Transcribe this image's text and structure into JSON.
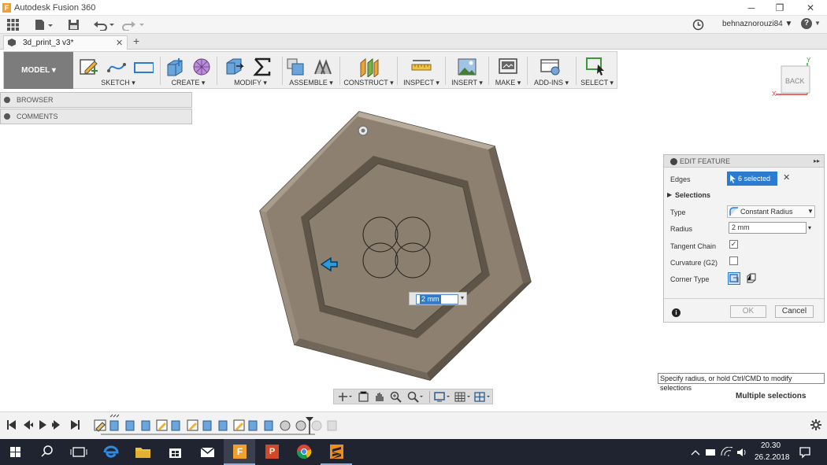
{
  "app": {
    "title": "Autodesk Fusion 360"
  },
  "window_controls": {
    "minimize": "─",
    "restore": "❐",
    "close": "✕"
  },
  "qat": {
    "user": "behnaznorouzi84 ▼",
    "help": "?"
  },
  "tab": {
    "name": "3d_print_3 v3*",
    "close": "✕",
    "add": "+"
  },
  "toolbar": {
    "workspace": "MODEL ▾",
    "groups": [
      {
        "label": "SKETCH ▾"
      },
      {
        "label": "CREATE ▾"
      },
      {
        "label": "MODIFY ▾"
      },
      {
        "label": "ASSEMBLE ▾"
      },
      {
        "label": "CONSTRUCT ▾"
      },
      {
        "label": "INSPECT ▾"
      },
      {
        "label": "INSERT ▾"
      },
      {
        "label": "MAKE ▾"
      },
      {
        "label": "ADD-INS ▾"
      },
      {
        "label": "SELECT ▾"
      }
    ]
  },
  "panels": {
    "browser": "BROWSER",
    "comments": "COMMENTS"
  },
  "viewcube": {
    "face": "BACK",
    "x": "X",
    "y": "Y"
  },
  "viewport": {
    "radius_input": "2 mm"
  },
  "edit_feature": {
    "title": "EDIT FEATURE",
    "edges_label": "Edges",
    "edges_value": "6 selected",
    "selections_label": "Selections",
    "type_label": "Type",
    "type_value": "Constant Radius",
    "radius_label": "Radius",
    "radius_value": "2 mm",
    "tangent_label": "Tangent Chain",
    "tangent_checked": true,
    "curvature_label": "Curvature (G2)",
    "curvature_checked": false,
    "corner_label": "Corner Type",
    "ok": "OK",
    "cancel": "Cancel"
  },
  "tooltip": "Specify radius, or hold Ctrl/CMD to modify selections",
  "status": "Multiple selections",
  "taskbar": {
    "time": "20.30",
    "date": "26.2.2018"
  },
  "colors": {
    "model_fill": "#8d8070",
    "model_edge": "#5e5447",
    "accent": "#2d7bd0",
    "taskbar": "#1f2430"
  }
}
